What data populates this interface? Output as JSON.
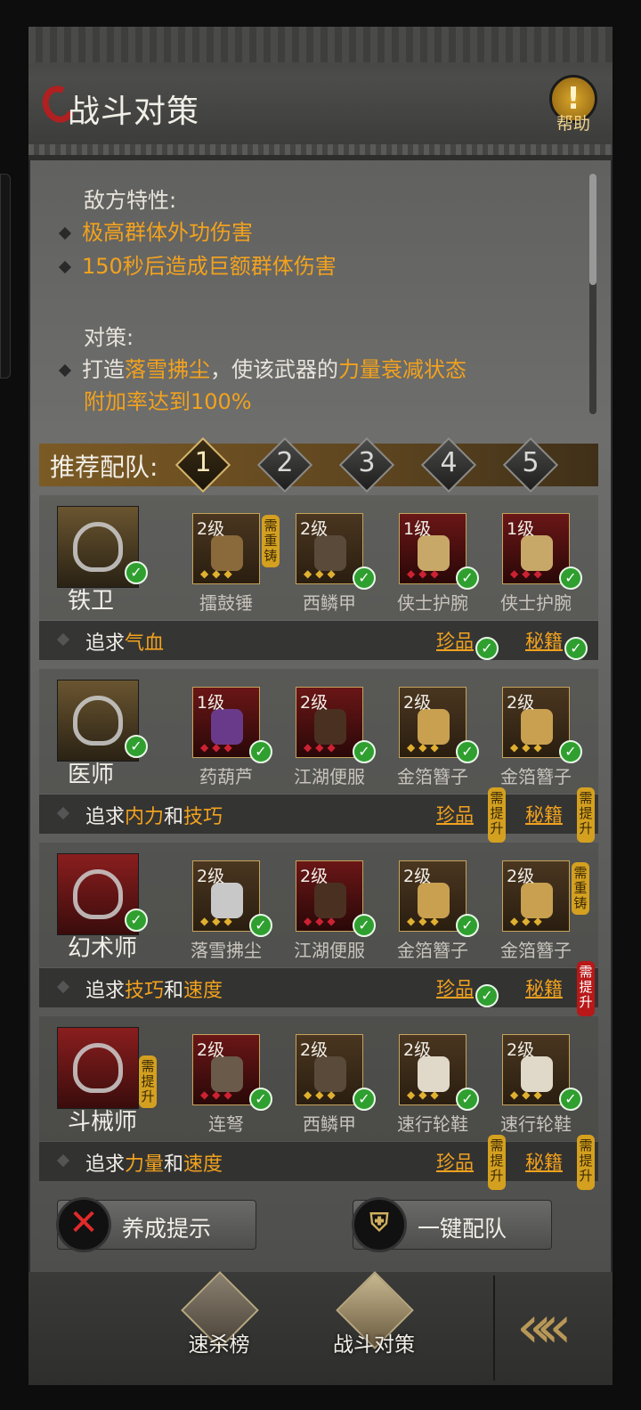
{
  "header": {
    "title": "战斗对策",
    "help_label": "帮助",
    "help_glyph": "!"
  },
  "info": {
    "enemy_label": "敌方特性:",
    "traits": [
      "极高群体外功伤害",
      "150秒后造成巨额群体伤害"
    ],
    "strategy_label": "对策:",
    "strategy_pre": "打造",
    "strategy_weapon": "落雪拂尘",
    "strategy_mid": "，使该武器的",
    "strategy_state": "力量衰减状态",
    "strategy_line2": "附加率达到100%"
  },
  "team": {
    "label": "推荐配队:",
    "tabs": [
      "1",
      "2",
      "3",
      "4",
      "5"
    ],
    "active_tab": "1"
  },
  "roles": [
    {
      "name": "铁卫",
      "role_check": true,
      "role_req": "",
      "items": [
        {
          "level": "2级",
          "name": "擂鼓锤",
          "check": false,
          "req": "需重铸",
          "req_color": "gold"
        },
        {
          "level": "2级",
          "name": "西鳞甲",
          "check": true,
          "req": ""
        },
        {
          "level": "1级",
          "name": "侠士护腕",
          "check": true,
          "req": ""
        },
        {
          "level": "1级",
          "name": "侠士护腕",
          "check": true,
          "req": ""
        }
      ],
      "pursue_prefix": "追求",
      "pursue_a": "气血",
      "pursue_and": "",
      "pursue_b": "",
      "treasure": "珍品",
      "treasure_check": true,
      "treasure_req": "",
      "manual": "秘籍",
      "manual_check": true,
      "manual_req": ""
    },
    {
      "name": "医师",
      "role_check": true,
      "role_req": "",
      "items": [
        {
          "level": "1级",
          "name": "药葫芦",
          "check": true,
          "req": ""
        },
        {
          "level": "2级",
          "name": "江湖便服",
          "check": true,
          "req": ""
        },
        {
          "level": "2级",
          "name": "金箔簪子",
          "check": true,
          "req": ""
        },
        {
          "level": "2级",
          "name": "金箔簪子",
          "check": true,
          "req": ""
        }
      ],
      "pursue_prefix": "追求",
      "pursue_a": "内力",
      "pursue_and": "和",
      "pursue_b": "技巧",
      "treasure": "珍品",
      "treasure_check": false,
      "treasure_req": "需提升",
      "manual": "秘籍",
      "manual_check": false,
      "manual_req": "需提升"
    },
    {
      "name": "幻术师",
      "role_check": true,
      "role_req": "",
      "items": [
        {
          "level": "2级",
          "name": "落雪拂尘",
          "check": true,
          "req": ""
        },
        {
          "level": "2级",
          "name": "江湖便服",
          "check": true,
          "req": ""
        },
        {
          "level": "2级",
          "name": "金箔簪子",
          "check": true,
          "req": ""
        },
        {
          "level": "2级",
          "name": "金箔簪子",
          "check": false,
          "req": "需重铸",
          "req_color": "gold"
        }
      ],
      "pursue_prefix": "追求",
      "pursue_a": "技巧",
      "pursue_and": "和",
      "pursue_b": "速度",
      "treasure": "珍品",
      "treasure_check": true,
      "treasure_req": "",
      "manual": "秘籍",
      "manual_check": false,
      "manual_req": "需提升",
      "manual_req_color": "red"
    },
    {
      "name": "斗械师",
      "role_check": false,
      "role_req": "需提升",
      "items": [
        {
          "level": "2级",
          "name": "连弩",
          "check": true,
          "req": ""
        },
        {
          "level": "2级",
          "name": "西鳞甲",
          "check": true,
          "req": ""
        },
        {
          "level": "2级",
          "name": "速行轮鞋",
          "check": true,
          "req": ""
        },
        {
          "level": "2级",
          "name": "速行轮鞋",
          "check": true,
          "req": ""
        }
      ],
      "pursue_prefix": "追求",
      "pursue_a": "力量",
      "pursue_and": "和",
      "pursue_b": "速度",
      "treasure": "珍品",
      "treasure_check": false,
      "treasure_req": "需提升",
      "manual": "秘籍",
      "manual_check": false,
      "manual_req": "需提升"
    }
  ],
  "actions": {
    "growth_tips": "养成提示",
    "auto_team": "一键配队"
  },
  "nav": {
    "speed_rank": "速杀榜",
    "battle_strategy": "战斗对策",
    "back_glyph": "«"
  },
  "colors": {
    "accent": "#f2a21e",
    "check": "#2f9f2f",
    "req_gold": "#d4a020",
    "req_red": "#b81818"
  }
}
